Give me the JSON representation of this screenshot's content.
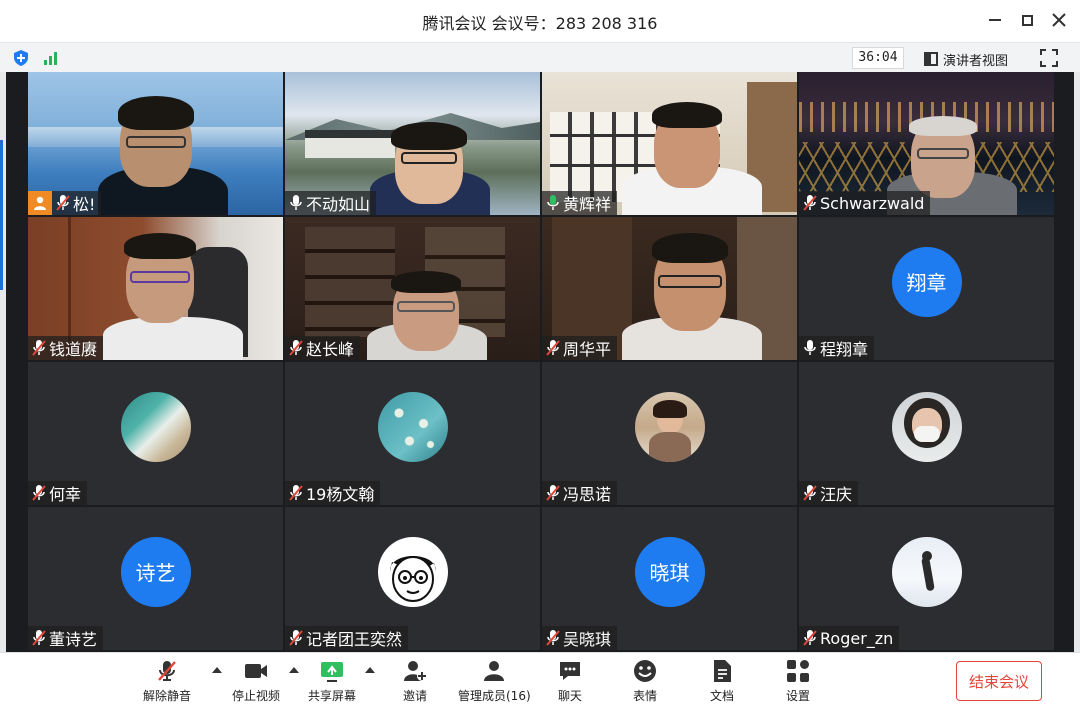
{
  "window": {
    "title": "腾讯会议 会议号：283 208 316"
  },
  "status": {
    "timer": "36:04",
    "speaker_view_label": "演讲者视图"
  },
  "participants": [
    {
      "name": "松!",
      "mic": "muted",
      "host": true,
      "kind": "video"
    },
    {
      "name": "不动如山",
      "mic": "on",
      "kind": "video"
    },
    {
      "name": "黄辉祥",
      "mic": "speaking",
      "kind": "video",
      "active": true
    },
    {
      "name": "Schwarzwald",
      "mic": "muted",
      "kind": "video"
    },
    {
      "name": "钱道赓",
      "mic": "muted",
      "kind": "video"
    },
    {
      "name": "赵长峰",
      "mic": "muted",
      "kind": "video"
    },
    {
      "name": "周华平",
      "mic": "muted",
      "kind": "video"
    },
    {
      "name": "程翔章",
      "mic": "on",
      "kind": "text-avatar",
      "avatar_text": "翔章"
    },
    {
      "name": "何幸",
      "mic": "muted",
      "kind": "image-avatar",
      "avatar_icon": "beach-photo-avatar"
    },
    {
      "name": "19杨文翰",
      "mic": "muted",
      "kind": "image-avatar",
      "avatar_icon": "almond-blossom-avatar"
    },
    {
      "name": "冯思诺",
      "mic": "muted",
      "kind": "image-avatar",
      "avatar_icon": "girl-photo-avatar"
    },
    {
      "name": "汪庆",
      "mic": "muted",
      "kind": "image-avatar",
      "avatar_icon": "masked-girl-avatar"
    },
    {
      "name": "董诗艺",
      "mic": "muted",
      "kind": "text-avatar",
      "avatar_text": "诗艺"
    },
    {
      "name": "记者团王奕然",
      "mic": "muted",
      "kind": "image-avatar",
      "avatar_icon": "cartoon-boy-avatar"
    },
    {
      "name": "吴晓琪",
      "mic": "muted",
      "kind": "text-avatar",
      "avatar_text": "晓琪"
    },
    {
      "name": "Roger_zn",
      "mic": "muted",
      "kind": "image-avatar",
      "avatar_icon": "snow-figure-avatar"
    }
  ],
  "toolbar": {
    "unmute": "解除静音",
    "stop_video": "停止视频",
    "share_screen": "共享屏幕",
    "invite": "邀请",
    "manage_members": "管理成员(16)",
    "chat": "聊天",
    "emoji": "表情",
    "docs": "文档",
    "settings": "设置",
    "end_meeting": "结束会议"
  },
  "colors": {
    "accent_blue": "#1f7cf0",
    "end_red": "#e0473a",
    "speaking_green": "#2fbf5f",
    "host_orange": "#f08a24"
  }
}
